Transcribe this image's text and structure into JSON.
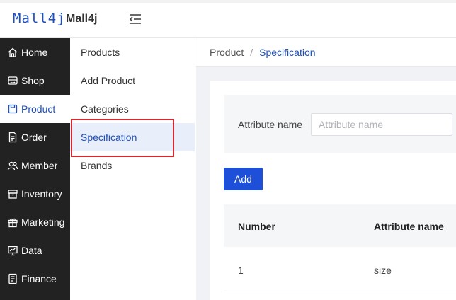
{
  "header": {
    "logo_text": "Mall4j",
    "brand": "Mall4j",
    "collapse_icon": "menu-fold-icon"
  },
  "sidebar": {
    "items": [
      {
        "label": "Home",
        "icon": "home-icon"
      },
      {
        "label": "Shop",
        "icon": "shop-icon"
      },
      {
        "label": "Product",
        "icon": "product-icon",
        "active": true
      },
      {
        "label": "Order",
        "icon": "order-icon"
      },
      {
        "label": "Member",
        "icon": "member-icon"
      },
      {
        "label": "Inventory",
        "icon": "inventory-icon"
      },
      {
        "label": "Marketing",
        "icon": "gift-icon"
      },
      {
        "label": "Data",
        "icon": "data-icon"
      },
      {
        "label": "Finance",
        "icon": "finance-icon"
      }
    ]
  },
  "submenu": {
    "items": [
      {
        "label": "Products"
      },
      {
        "label": "Add Product"
      },
      {
        "label": "Categories"
      },
      {
        "label": "Specification",
        "active": true
      },
      {
        "label": "Brands"
      }
    ]
  },
  "breadcrumb": {
    "parent": "Product",
    "separator": "/",
    "current": "Specification"
  },
  "search": {
    "label": "Attribute name",
    "placeholder": "Attribute name",
    "value": ""
  },
  "actions": {
    "add_label": "Add"
  },
  "table": {
    "columns": [
      "Number",
      "Attribute name"
    ],
    "rows": [
      [
        "1",
        "size"
      ]
    ]
  },
  "colors": {
    "accent": "#1d4fbd",
    "sidebar_bg": "#222222",
    "highlight": "#d6282f"
  }
}
